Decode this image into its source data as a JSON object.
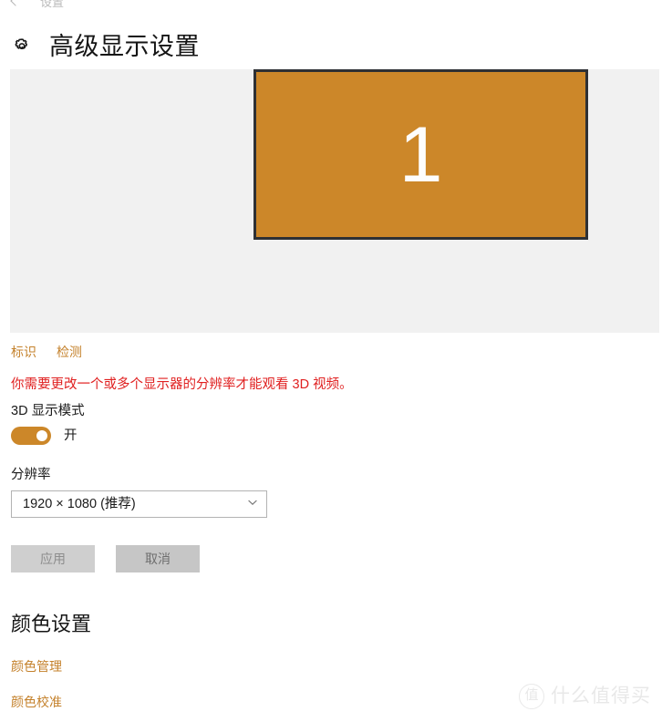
{
  "topnav": {
    "back_icon": "back-arrow-icon",
    "title": "设置"
  },
  "header": {
    "icon": "gear-icon",
    "title": "高级显示设置"
  },
  "preview": {
    "monitor_number": "1",
    "monitor_color": "#cc8729",
    "panel_color": "#f1f1f1",
    "border_color": "#2e3034"
  },
  "actions": {
    "identify_label": "标识",
    "detect_label": "检测",
    "link_color": "#c4812b"
  },
  "warning": {
    "text": "你需要更改一个或多个显示器的分辨率才能观看 3D 视频。",
    "color": "#e02020"
  },
  "display_mode": {
    "label": "3D 显示模式",
    "toggle_state": "开",
    "toggle_on": true,
    "accent_color": "#cc8729"
  },
  "resolution": {
    "label": "分辨率",
    "selected": "1920 × 1080 (推荐)",
    "chevron_icon": "chevron-down-icon"
  },
  "buttons": {
    "apply_label": "应用",
    "cancel_label": "取消"
  },
  "color_settings": {
    "title": "颜色设置",
    "links": [
      {
        "label": "颜色管理"
      },
      {
        "label": "颜色校准"
      }
    ]
  },
  "watermark": {
    "badge": "值",
    "text": "什么值得买"
  }
}
